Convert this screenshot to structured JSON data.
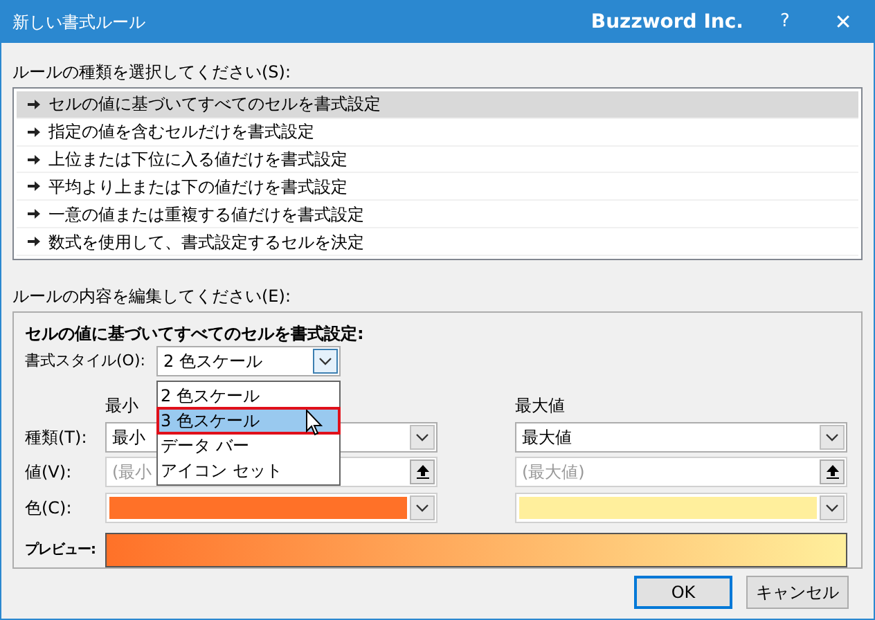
{
  "window": {
    "title": "新しい書式ルール",
    "brand": "Buzzword Inc.",
    "help": "?",
    "close": "✕"
  },
  "rule_type_label": "ルールの種類を選択してください(S):",
  "rule_types": [
    {
      "label": "セルの値に基づいてすべてのセルを書式設定",
      "selected": true
    },
    {
      "label": "指定の値を含むセルだけを書式設定",
      "selected": false
    },
    {
      "label": "上位または下位に入る値だけを書式設定",
      "selected": false
    },
    {
      "label": "平均より上または下の値だけを書式設定",
      "selected": false
    },
    {
      "label": "一意の値または重複する値だけを書式設定",
      "selected": false
    },
    {
      "label": "数式を使用して、書式設定するセルを決定",
      "selected": false
    }
  ],
  "edit_label": "ルールの内容を編集してください(E):",
  "edit": {
    "heading": "セルの値に基づいてすべてのセルを書式設定:",
    "style_label": "書式スタイル(O):",
    "style_value": "2 色スケール",
    "style_options": [
      {
        "label": "2 色スケール",
        "selected": false
      },
      {
        "label": "3 色スケール",
        "selected": true
      },
      {
        "label": "データ バー",
        "selected": false
      },
      {
        "label": "アイコン セット",
        "selected": false
      }
    ],
    "type_label": "種類(T):",
    "value_label": "値(V):",
    "color_label": "色(C):",
    "columns": [
      {
        "header": "最小",
        "type": "最小",
        "value_placeholder": "(最小",
        "color": "#ff7128"
      },
      {
        "header": "最大値",
        "type": "最大値",
        "value_placeholder": "(最大値)",
        "color": "#ffef9c"
      }
    ],
    "preview_label": "プレビュー:"
  },
  "buttons": [
    "OK",
    "キャンセル"
  ]
}
